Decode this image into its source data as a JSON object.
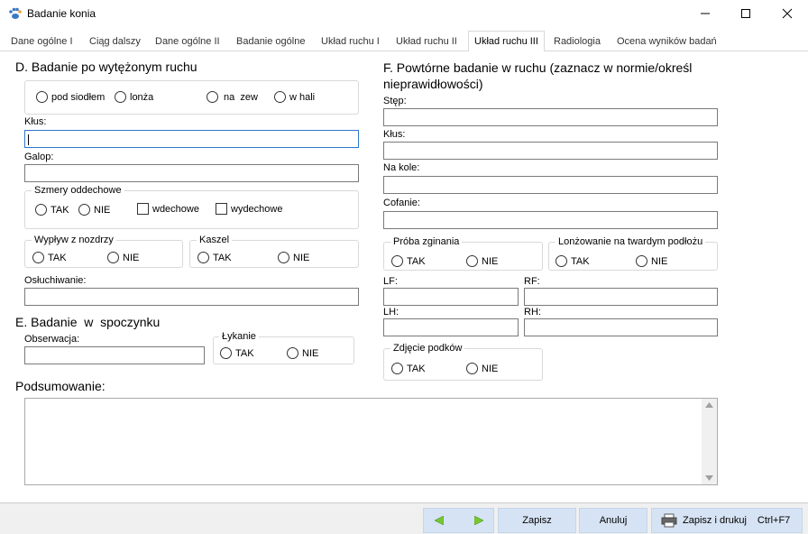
{
  "window": {
    "title": "Badanie konia"
  },
  "tabs": [
    {
      "label": "Dane ogólne I"
    },
    {
      "label": "Ciąg dalszy"
    },
    {
      "label": "Dane ogólne II"
    },
    {
      "label": "Badanie ogólne"
    },
    {
      "label": "Układ ruchu I"
    },
    {
      "label": "Układ ruchu II"
    },
    {
      "label": "Układ ruchu III"
    },
    {
      "label": "Radiologia"
    },
    {
      "label": "Ocena wyników badań"
    }
  ],
  "sectionD": {
    "title": "D. Badanie po wytężonym ruchu",
    "options": [
      "pod siodłem",
      "lonża",
      "na  zew",
      "w hali"
    ],
    "klus_label": "Kłus:",
    "galop_label": "Galop:",
    "szmery": {
      "legend": "Szmery oddechowe",
      "tak": "TAK",
      "nie": "NIE",
      "wdechowe": "wdechowe",
      "wydechowe": "wydechowe"
    },
    "wyplyw": {
      "legend": "Wypływ z nozdrzy",
      "tak": "TAK",
      "nie": "NIE"
    },
    "kaszel": {
      "legend": "Kaszel",
      "tak": "TAK",
      "nie": "NIE"
    },
    "osluchiwanie_label": "Osłuchiwanie:"
  },
  "sectionE": {
    "title": "E. Badanie  w  spoczynku",
    "obserwacja_label": "Obserwacja:",
    "lykanie": {
      "legend": "Łykanie",
      "tak": "TAK",
      "nie": "NIE"
    }
  },
  "sectionF": {
    "title": "F. Powtórne badanie w ruchu (zaznacz w normie/określ nieprawidłowości)",
    "stepa_label": "Stęp:",
    "klus_label": "Kłus:",
    "nakole_label": "Na kole:",
    "cofanie_label": "Cofanie:",
    "proba": {
      "legend": "Próba zginania",
      "tak": "TAK",
      "nie": "NIE"
    },
    "lonzowanie": {
      "legend": "Lonżowanie na twardym podłożu",
      "tak": "TAK",
      "nie": "NIE"
    },
    "lf_label": "LF:",
    "rf_label": "RF:",
    "lh_label": "LH:",
    "rh_label": "RH:",
    "zdjecie": {
      "legend": "Zdjęcie podków",
      "tak": "TAK",
      "nie": "NIE"
    }
  },
  "podsumowanie": {
    "label": "Podsumowanie:"
  },
  "buttons": {
    "zapisz": "Zapisz",
    "anuluj": "Anuluj",
    "zapisz_drukuj": "Zapisz i drukuj",
    "shortcut": "Ctrl+F7"
  },
  "colors": {
    "accent": "#2f78c9",
    "button_bg": "#d6e3f4",
    "arrow_green": "#78c832"
  }
}
